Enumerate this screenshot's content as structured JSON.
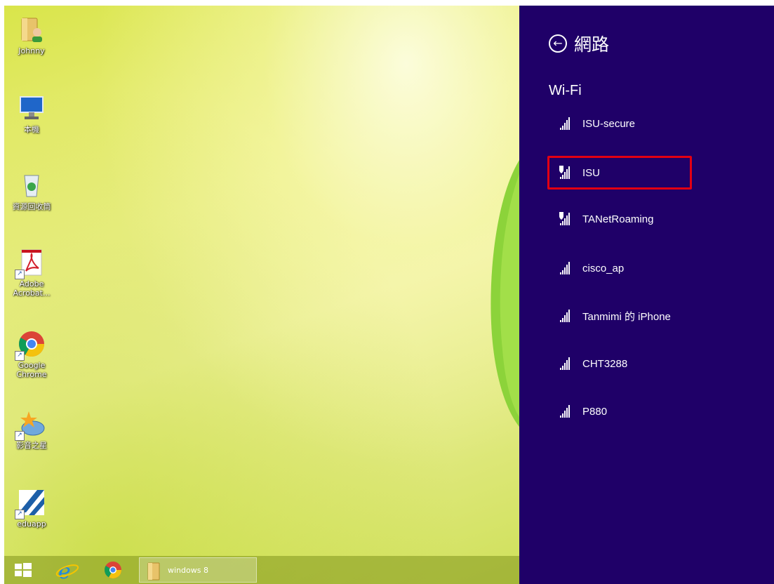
{
  "desktop": {
    "icons": [
      {
        "label": "Johnny",
        "icon": "user-folder-icon"
      },
      {
        "label": "本機",
        "icon": "computer-icon"
      },
      {
        "label": "資源回收筒",
        "icon": "recycle-bin-icon"
      },
      {
        "label": "Adobe Acrobat...",
        "icon": "adobe-acrobat-icon"
      },
      {
        "label": "Google Chrome",
        "icon": "chrome-icon"
      },
      {
        "label": "影音之星",
        "icon": "media-player-icon"
      },
      {
        "label": "eduapp",
        "icon": "eduapp-icon"
      }
    ]
  },
  "taskbar": {
    "start_icon": "windows-logo-icon",
    "pinned": [
      "internet-explorer-icon",
      "chrome-icon"
    ],
    "task_label": "windows 8"
  },
  "network_panel": {
    "title": "網路",
    "back_icon": "back-arrow-icon",
    "section": "Wi-Fi",
    "networks": [
      {
        "name": "ISU-secure",
        "secured_shield": false,
        "highlighted": false
      },
      {
        "name": "ISU",
        "secured_shield": true,
        "highlighted": true
      },
      {
        "name": "TANetRoaming",
        "secured_shield": true,
        "highlighted": false
      },
      {
        "name": "cisco_ap",
        "secured_shield": false,
        "highlighted": false
      },
      {
        "name": "Tanmimi 的 iPhone",
        "secured_shield": false,
        "highlighted": false
      },
      {
        "name": "CHT3288",
        "secured_shield": false,
        "highlighted": false
      },
      {
        "name": "P880",
        "secured_shield": false,
        "highlighted": false
      }
    ],
    "highlight_color": "#e30012",
    "background_color": "#1f0068"
  }
}
